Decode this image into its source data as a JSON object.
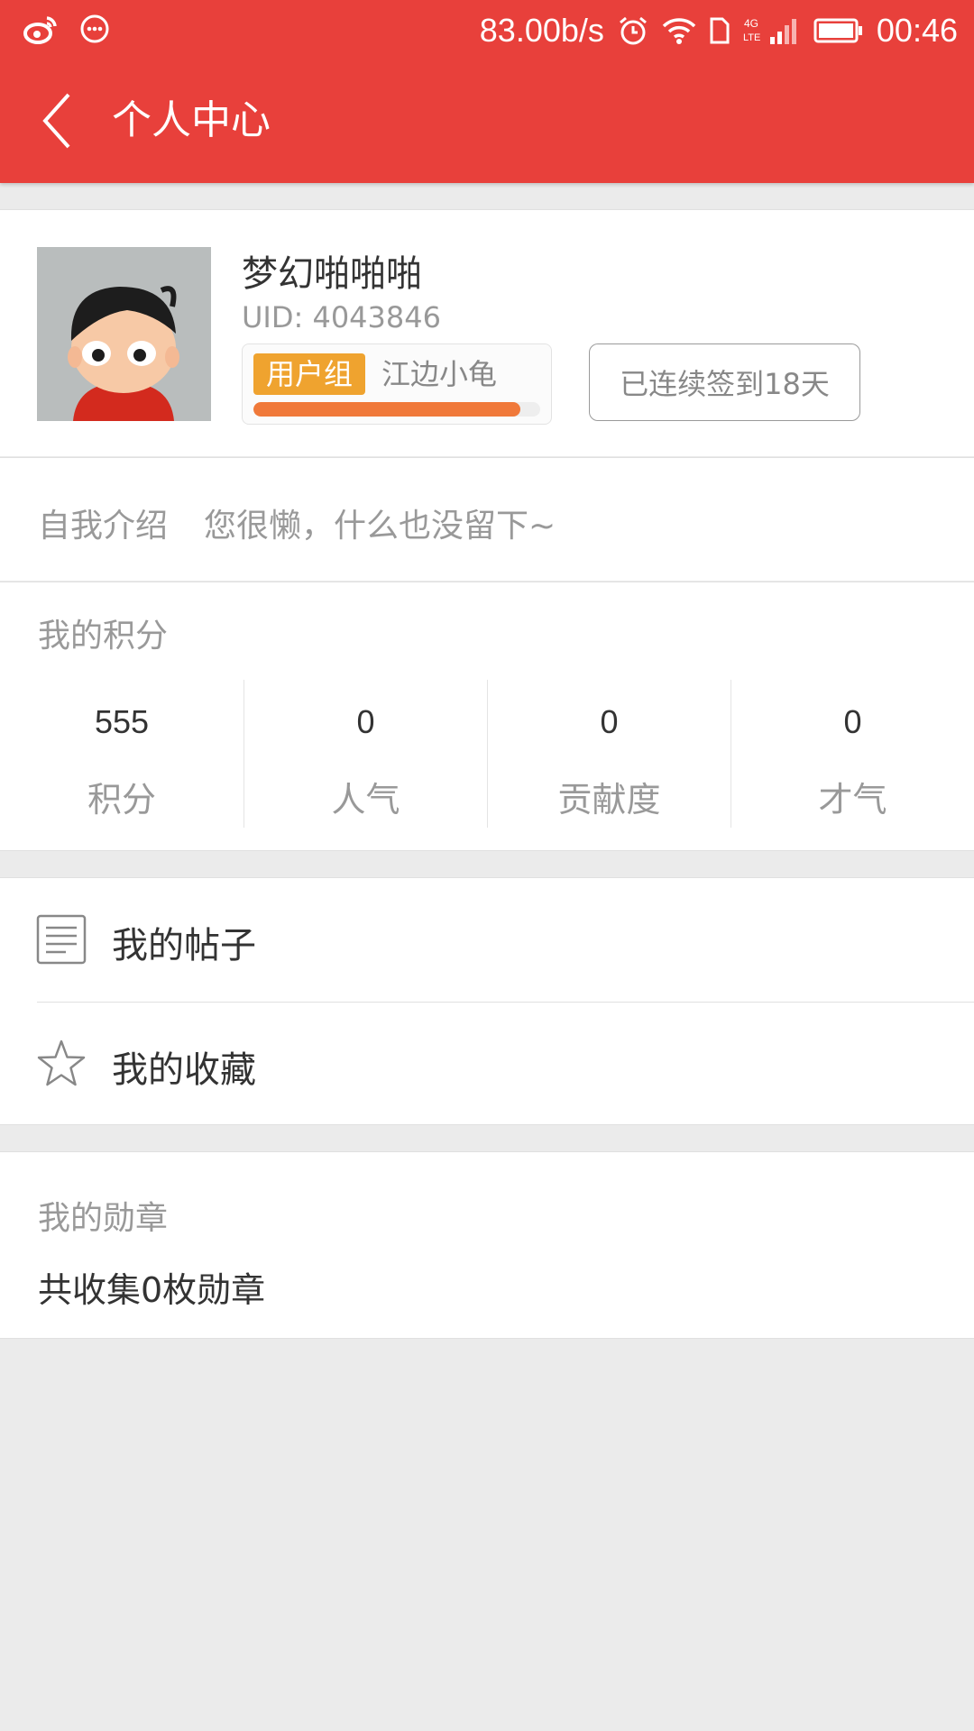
{
  "status_bar": {
    "network_speed": "83.00b/s",
    "time": "00:46",
    "icons": [
      "weibo-icon",
      "message-icon",
      "alarm-icon",
      "wifi-icon",
      "sim-icon",
      "4g-lte-signal-icon",
      "battery-icon"
    ],
    "network_type_top": "4G",
    "network_type_bottom": "LTE"
  },
  "header": {
    "title": "个人中心",
    "back_icon": "chevron-left-icon",
    "background_color": "#e8403b"
  },
  "profile": {
    "username": "梦幻啪啪啪",
    "uid_label": "UID:",
    "uid_value": "4043846",
    "group_tag": "用户组",
    "group_name": "江边小龟",
    "group_progress": 0.93,
    "signin_text": "已连续签到18天"
  },
  "intro": {
    "label": "自我介绍",
    "text": "您很懒，什么也没留下~"
  },
  "points": {
    "title": "我的积分",
    "stats": [
      {
        "value": "555",
        "label": "积分"
      },
      {
        "value": "0",
        "label": "人气"
      },
      {
        "value": "0",
        "label": "贡献度"
      },
      {
        "value": "0",
        "label": "才气"
      }
    ]
  },
  "menu": {
    "items": [
      {
        "label": "我的帖子",
        "icon": "document-icon"
      },
      {
        "label": "我的收藏",
        "icon": "star-icon"
      }
    ]
  },
  "medals": {
    "title": "我的勋章",
    "summary": "共收集0枚勋章"
  }
}
